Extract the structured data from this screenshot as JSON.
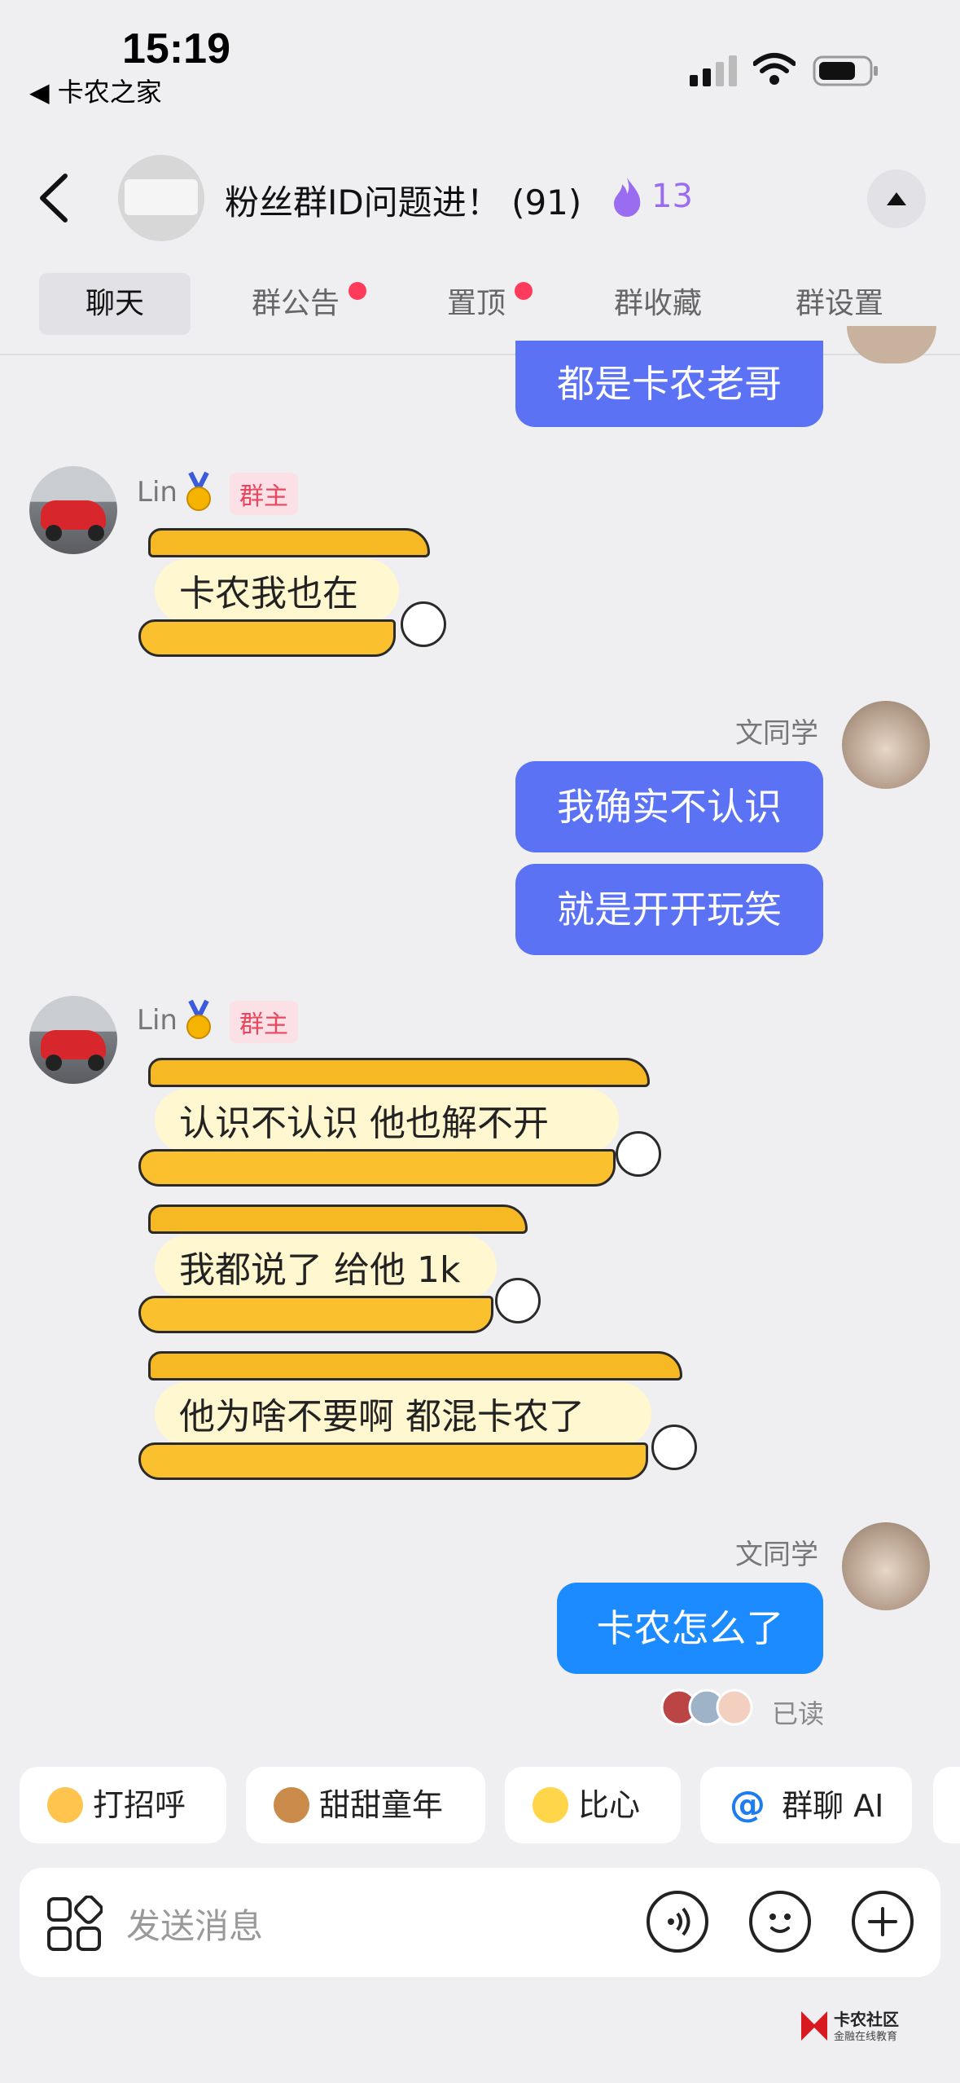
{
  "status_bar": {
    "time": "15:19",
    "back_app": "◀ 卡农之家"
  },
  "header": {
    "group_title": "粉丝群ID问题进！ (91)",
    "fire_count": "13",
    "accent": "#9a6cf0"
  },
  "tabs": [
    {
      "label": "聊天",
      "active": true,
      "badge": false
    },
    {
      "label": "群公告",
      "active": false,
      "badge": true
    },
    {
      "label": "置顶",
      "active": false,
      "badge": true
    },
    {
      "label": "群收藏",
      "active": false,
      "badge": false
    },
    {
      "label": "群设置",
      "active": false,
      "badge": false
    }
  ],
  "messages": {
    "m0": {
      "text": "都是卡农老哥",
      "side": "right"
    },
    "lin1": {
      "sender": "Lin",
      "tag": "群主",
      "texts": [
        "卡农我也在"
      ]
    },
    "wen1": {
      "sender": "文同学",
      "texts": [
        "我确实不认识",
        "就是开开玩笑"
      ]
    },
    "lin2": {
      "sender": "Lin",
      "tag": "群主",
      "texts": [
        "认识不认识 他也解不开",
        "我都说了 给他 1k",
        "他为啥不要啊 都混卡农了"
      ]
    },
    "wen2": {
      "sender": "文同学",
      "texts": [
        "卡农怎么了"
      ],
      "read_status": "已读"
    }
  },
  "quick_replies": [
    {
      "label": "打招呼",
      "icon": "smile-wave-icon"
    },
    {
      "label": "甜甜童年",
      "icon": "cookie-icon"
    },
    {
      "label": "比心",
      "icon": "heart-duck-icon"
    },
    {
      "label": "群聊 AI",
      "icon": "at-icon"
    }
  ],
  "input": {
    "placeholder": "发送消息"
  },
  "watermark": {
    "name": "卡农社区",
    "tagline": "金融在线教育"
  }
}
